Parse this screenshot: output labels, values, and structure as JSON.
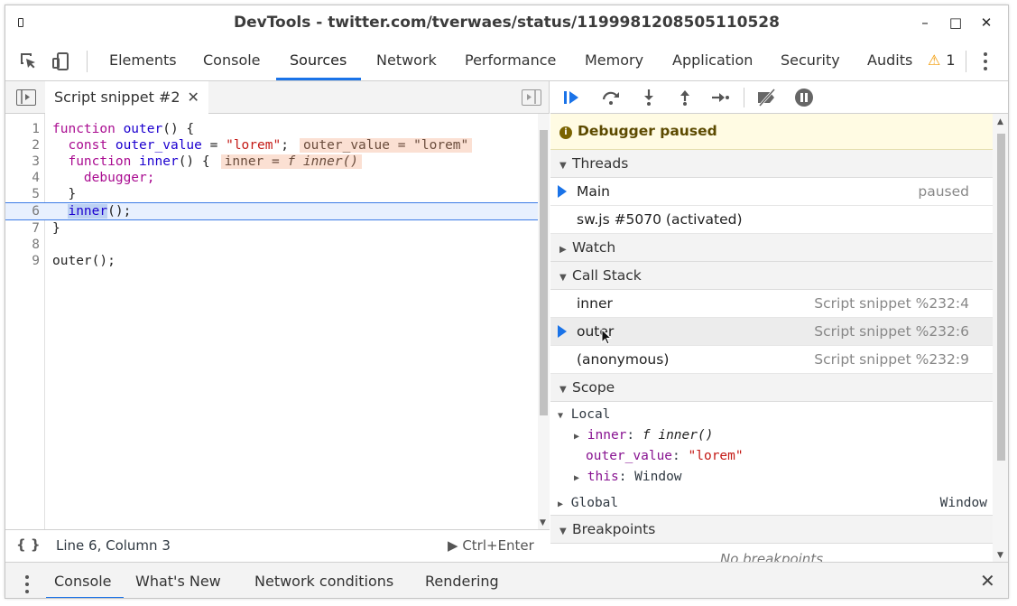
{
  "window": {
    "title": "DevTools - twitter.com/tverwaes/status/1199981208505110528",
    "controls": [
      "–",
      "□",
      "✕"
    ]
  },
  "tabs": [
    "Elements",
    "Console",
    "Sources",
    "Network",
    "Performance",
    "Memory",
    "Application",
    "Security",
    "Audits"
  ],
  "warning_count": "1",
  "editor": {
    "file_tab": "Script snippet #2",
    "lines": [
      {
        "n": "1"
      },
      {
        "n": "2"
      },
      {
        "n": "3"
      },
      {
        "n": "4"
      },
      {
        "n": "5"
      },
      {
        "n": "6"
      },
      {
        "n": "7"
      },
      {
        "n": "8"
      },
      {
        "n": "9"
      }
    ],
    "code": {
      "l1_kw": "function",
      "l1_name": "outer",
      "l1_rest": "() {",
      "l2_kw": "const",
      "l2_var": "outer_value",
      "l2_eq": " = ",
      "l2_str": "\"lorem\"",
      "l2_end": ";",
      "l2_inline": "outer_value = \"lorem\"",
      "l3_kw": "function",
      "l3_name": "inner",
      "l3_rest": "() {",
      "l3_inline_pre": "inner = ",
      "l3_inline_f": "f inner()",
      "l4": "debugger;",
      "l5": "}",
      "l6_hl": "inner",
      "l6_rest": "();",
      "l7": "}",
      "l9": "outer();"
    },
    "status_position": "Line 6, Column 3",
    "run_label": "Ctrl+Enter"
  },
  "debugger": {
    "paused_message": "Debugger paused",
    "threads_header": "Threads",
    "threads": [
      {
        "name": "Main",
        "state": "paused"
      },
      {
        "name": "sw.js #5070 (activated)",
        "state": ""
      }
    ],
    "watch_header": "Watch",
    "callstack_header": "Call Stack",
    "callstack": [
      {
        "fn": "inner",
        "loc": "Script snippet %232:4"
      },
      {
        "fn": "outer",
        "loc": "Script snippet %232:6"
      },
      {
        "fn": "(anonymous)",
        "loc": "Script snippet %232:9"
      }
    ],
    "scope_header": "Scope",
    "scope": {
      "local_label": "Local",
      "inner_key": "inner",
      "inner_val": "f inner()",
      "outer_key": "outer_value",
      "outer_val": "\"lorem\"",
      "this_key": "this",
      "this_val": "Window",
      "global_label": "Global",
      "global_val": "Window"
    },
    "breakpoints_header": "Breakpoints",
    "no_breakpoints": "No breakpoints"
  },
  "drawer": {
    "tabs": [
      "Console",
      "What's New",
      "Network conditions",
      "Rendering"
    ]
  },
  "colors": {
    "accent": "#1a73e8",
    "keyword": "#aa0d91",
    "string": "#c41a16",
    "paused_bg": "#fffbe3"
  }
}
